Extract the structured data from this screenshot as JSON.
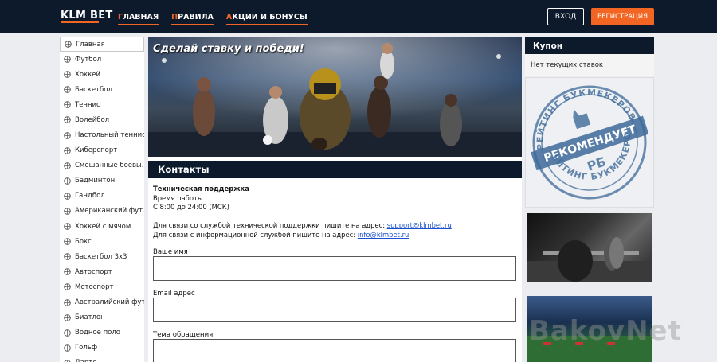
{
  "header": {
    "logo": "KLM BET",
    "nav": [
      {
        "first": "Г",
        "rest": "ЛАВНАЯ"
      },
      {
        "first": "П",
        "rest": "РАВИЛА"
      },
      {
        "first": "А",
        "rest": "КЦИИ И БОНУСЫ"
      }
    ],
    "login_label": "ВХОД",
    "register_label": "РЕГИСТРАЦИЯ",
    "accent_color": "#f26522",
    "bar_color": "#0d1a2b"
  },
  "sidebar": {
    "items": [
      {
        "label": "Главная",
        "icon": "globe-icon"
      },
      {
        "label": "Футбол",
        "icon": "soccer-ball-icon"
      },
      {
        "label": "Хоккей",
        "icon": "hockey-icon"
      },
      {
        "label": "Баскетбол",
        "icon": "basketball-icon"
      },
      {
        "label": "Теннис",
        "icon": "tennis-ball-icon"
      },
      {
        "label": "Волейбол",
        "icon": "volleyball-icon"
      },
      {
        "label": "Настольный теннис",
        "icon": "table-tennis-icon"
      },
      {
        "label": "Киберспорт",
        "icon": "esports-icon"
      },
      {
        "label": "Смешанные боевы...",
        "icon": "mma-icon"
      },
      {
        "label": "Бадминтон",
        "icon": "badminton-icon"
      },
      {
        "label": "Гандбол",
        "icon": "handball-icon"
      },
      {
        "label": "Американский фут...",
        "icon": "american-football-icon"
      },
      {
        "label": "Хоккей с мячом",
        "icon": "bandy-icon"
      },
      {
        "label": "Бокс",
        "icon": "boxing-icon"
      },
      {
        "label": "Баскетбол 3x3",
        "icon": "basketball-3x3-icon"
      },
      {
        "label": "Автоспорт",
        "icon": "motorsport-icon"
      },
      {
        "label": "Мотоспорт",
        "icon": "motorcycle-icon"
      },
      {
        "label": "Австралийский фут...",
        "icon": "aussie-rules-icon"
      },
      {
        "label": "Биатлон",
        "icon": "biathlon-icon"
      },
      {
        "label": "Водное поло",
        "icon": "water-polo-icon"
      },
      {
        "label": "Гольф",
        "icon": "golf-icon"
      },
      {
        "label": "Дартс",
        "icon": "darts-icon"
      }
    ]
  },
  "main": {
    "banner_title": "Сделай ставку и победи!",
    "section_title": "Контакты",
    "support_title": "Техническая поддержка",
    "hours_label": "Время работы",
    "hours_value": "С 8:00 до 24:00 (МСК)",
    "tech_text": "Для связи со службой технической поддержки пишите на адрес:",
    "tech_email": "support@klmbet.ru",
    "info_text": "Для связи с информационной службой пишите на адрес:",
    "info_email": "info@klmbet.ru",
    "name_label": "Ваше имя",
    "email_label": "Email адрес",
    "subject_label": "Тема обращения"
  },
  "right": {
    "coupon_title": "Купон",
    "coupon_empty": "Нет текущих ставок",
    "stamp_top": "РЕЙТИНГ БУКМЕКЕРОВ",
    "stamp_middle": "РЕКОМЕНДУЕТ",
    "stamp_logo": "РБ",
    "stamp_bottom": "РЕЙТИНГ БУКМЕКЕРОВ",
    "stamp_color": "#3d6a99",
    "watermark": "BakovNet"
  }
}
